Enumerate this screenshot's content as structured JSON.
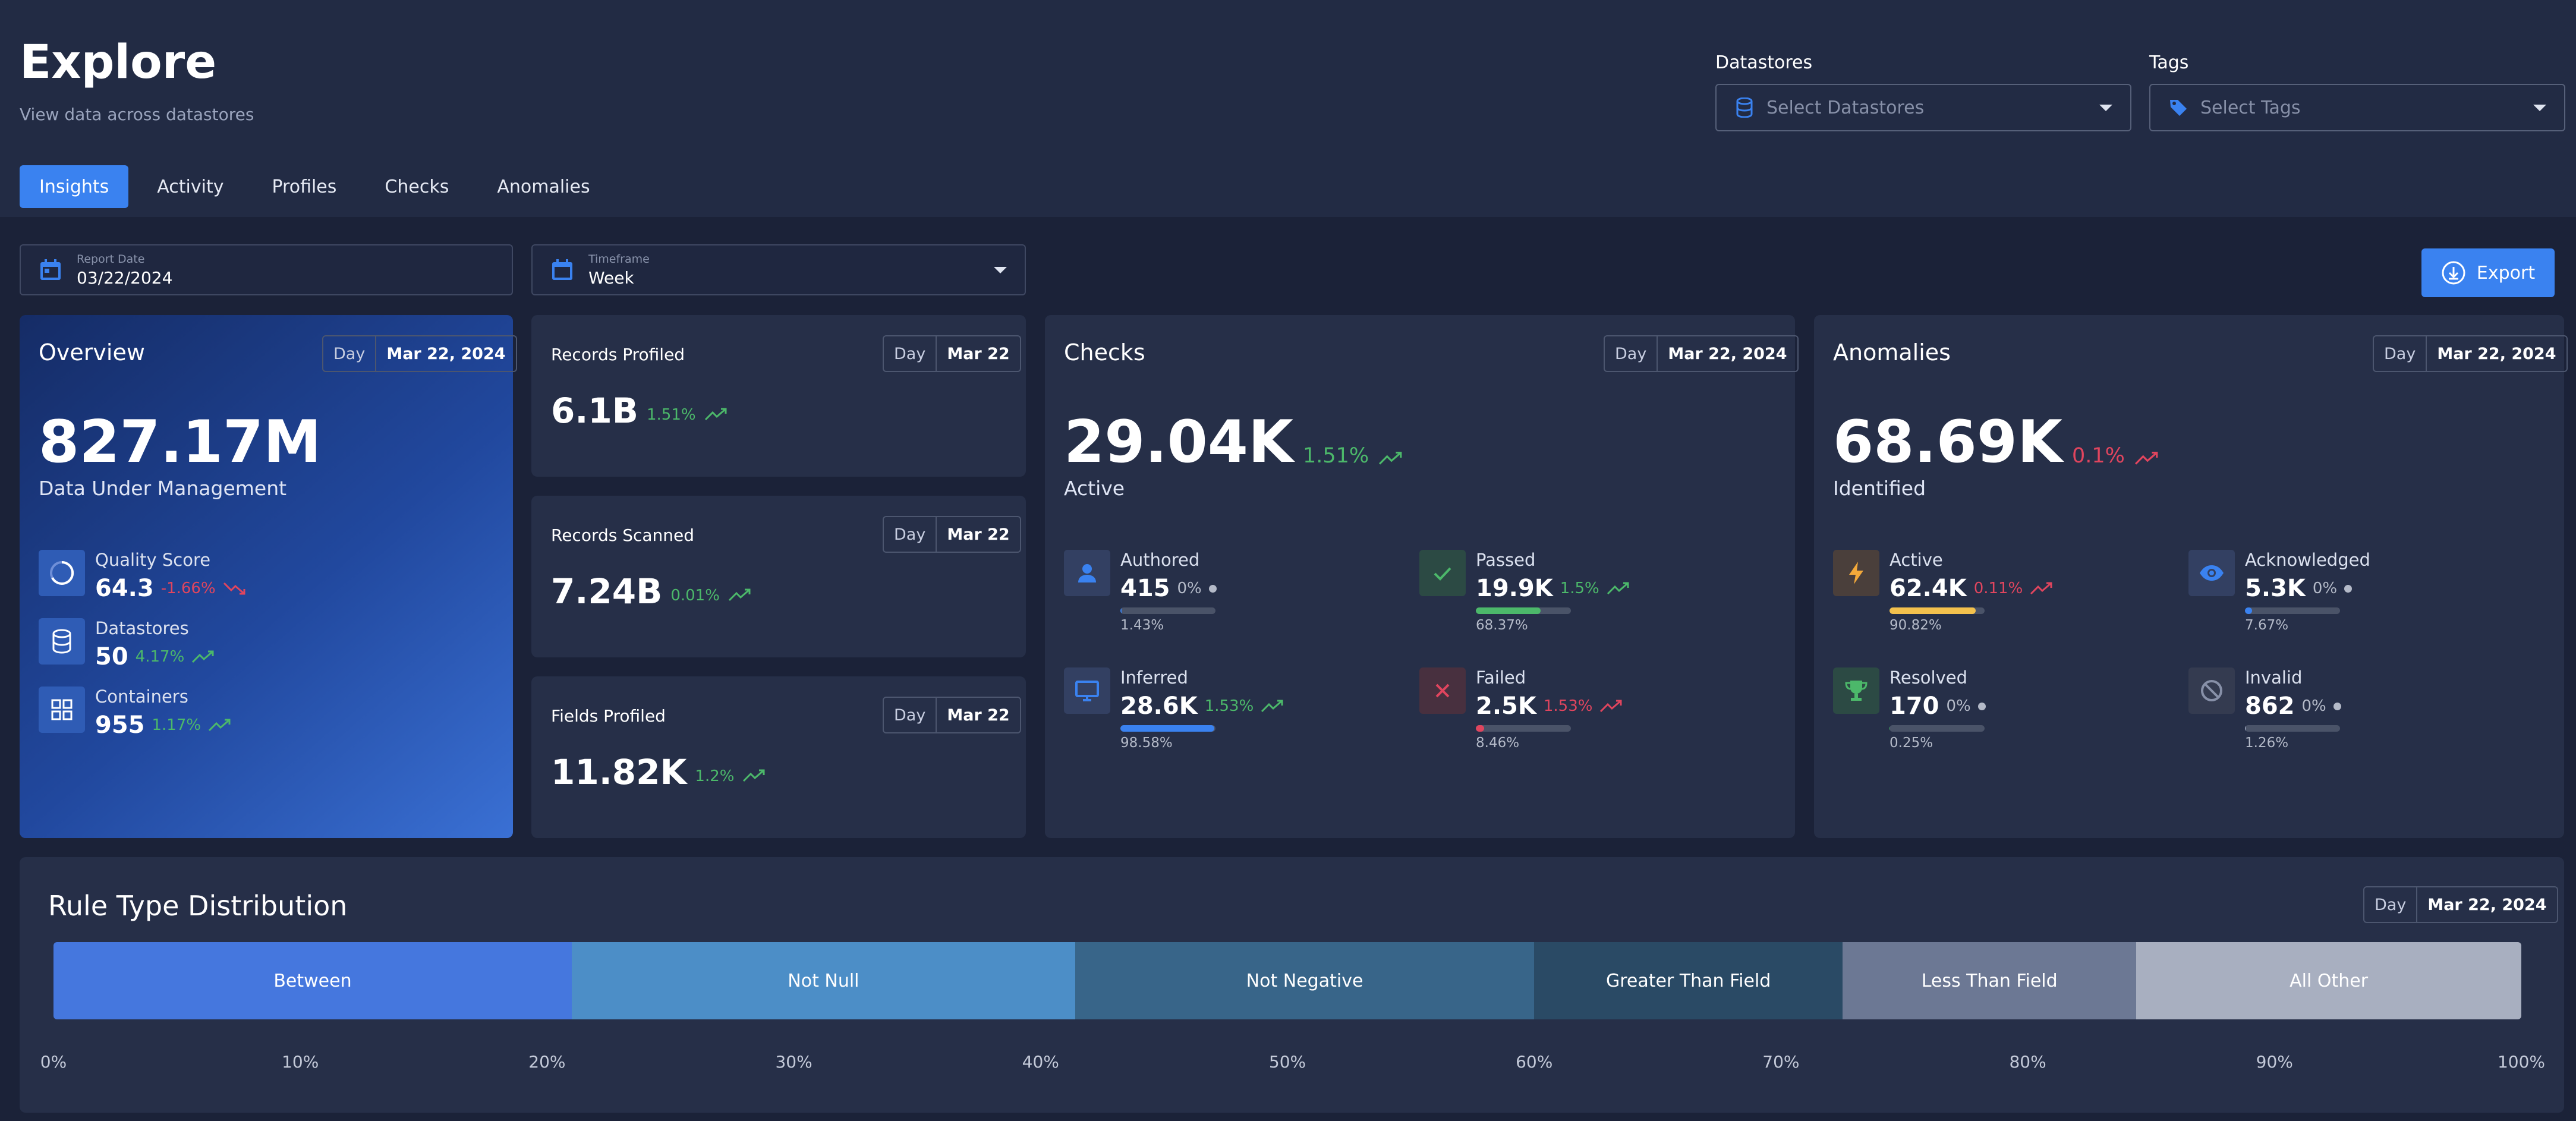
{
  "header": {
    "title": "Explore",
    "subtitle": "View data across datastores",
    "datastores": {
      "label": "Datastores",
      "placeholder": "Select Datastores"
    },
    "tags": {
      "label": "Tags",
      "placeholder": "Select Tags"
    }
  },
  "tabs": [
    {
      "label": "Insights",
      "active": true
    },
    {
      "label": "Activity"
    },
    {
      "label": "Profiles"
    },
    {
      "label": "Checks"
    },
    {
      "label": "Anomalies"
    }
  ],
  "toolbar": {
    "report_date": {
      "label": "Report Date",
      "value": "03/22/2024"
    },
    "timeframe": {
      "label": "Timeframe",
      "value": "Week"
    },
    "export_label": "Export"
  },
  "overview": {
    "title": "Overview",
    "period": "Day",
    "date": "Mar 22, 2024",
    "value": "827.17M",
    "caption": "Data Under Management",
    "stats": [
      {
        "name": "Quality Score",
        "value": "64.3",
        "change": "-1.66%",
        "trend": "down"
      },
      {
        "name": "Datastores",
        "value": "50",
        "change": "4.17%",
        "trend": "up"
      },
      {
        "name": "Containers",
        "value": "955",
        "change": "1.17%",
        "trend": "up"
      }
    ]
  },
  "records_profiled": {
    "title": "Records Profiled",
    "period": "Day",
    "date": "Mar 22",
    "value": "6.1B",
    "change": "1.51%"
  },
  "records_scanned": {
    "title": "Records Scanned",
    "period": "Day",
    "date": "Mar 22",
    "value": "7.24B",
    "change": "0.01%"
  },
  "fields_profiled": {
    "title": "Fields Profiled",
    "period": "Day",
    "date": "Mar 22",
    "value": "11.82K",
    "change": "1.2%"
  },
  "checks": {
    "title": "Checks",
    "period": "Day",
    "date": "Mar 22, 2024",
    "value": "29.04K",
    "change": "1.51%",
    "caption": "Active",
    "stats": [
      {
        "name": "Authored",
        "value": "415",
        "change": "0%",
        "bar_pct": "1.43%",
        "fill": 0.0143
      },
      {
        "name": "Passed",
        "value": "19.9K",
        "change": "1.5%",
        "bar_pct": "68.37%",
        "fill": 0.6837
      },
      {
        "name": "Inferred",
        "value": "28.6K",
        "change": "1.53%",
        "bar_pct": "98.58%",
        "fill": 0.9858
      },
      {
        "name": "Failed",
        "value": "2.5K",
        "change": "1.53%",
        "bar_pct": "8.46%",
        "fill": 0.0846
      }
    ]
  },
  "anomalies": {
    "title": "Anomalies",
    "period": "Day",
    "date": "Mar 22, 2024",
    "value": "68.69K",
    "change": "0.1%",
    "caption": "Identified",
    "stats": [
      {
        "name": "Active",
        "value": "62.4K",
        "change": "0.11%",
        "bar_pct": "90.82%",
        "fill": 0.9082
      },
      {
        "name": "Acknowledged",
        "value": "5.3K",
        "change": "0%",
        "bar_pct": "7.67%",
        "fill": 0.0767
      },
      {
        "name": "Resolved",
        "value": "170",
        "change": "0%",
        "bar_pct": "0.25%",
        "fill": 0.0025
      },
      {
        "name": "Invalid",
        "value": "862",
        "change": "0%",
        "bar_pct": "1.26%",
        "fill": 0.0126
      }
    ]
  },
  "rule_distribution": {
    "title": "Rule Type Distribution",
    "period": "Day",
    "date": "Mar 22, 2024",
    "segments": [
      {
        "label": "Between",
        "share": 21,
        "color": "#4577de"
      },
      {
        "label": "Not Null",
        "share": 20.4,
        "color": "#4c8ec7"
      },
      {
        "label": "Not Negative",
        "share": 18.6,
        "color": "#386589"
      },
      {
        "label": "Greater Than Field",
        "share": 12.5,
        "color": "#2a4a65"
      },
      {
        "label": "Less Than Field",
        "share": 11.9,
        "color": "#6c7894"
      },
      {
        "label": "All Other",
        "share": 15.6,
        "color": "#a8afc0"
      }
    ],
    "ticks": [
      "0%",
      "10%",
      "20%",
      "30%",
      "40%",
      "50%",
      "60%",
      "70%",
      "80%",
      "90%",
      "100%"
    ]
  },
  "colors": {
    "accent": "#3a82f0",
    "positive": "#4cb86a",
    "negative": "#e0455e",
    "warning": "#f3c14d"
  }
}
